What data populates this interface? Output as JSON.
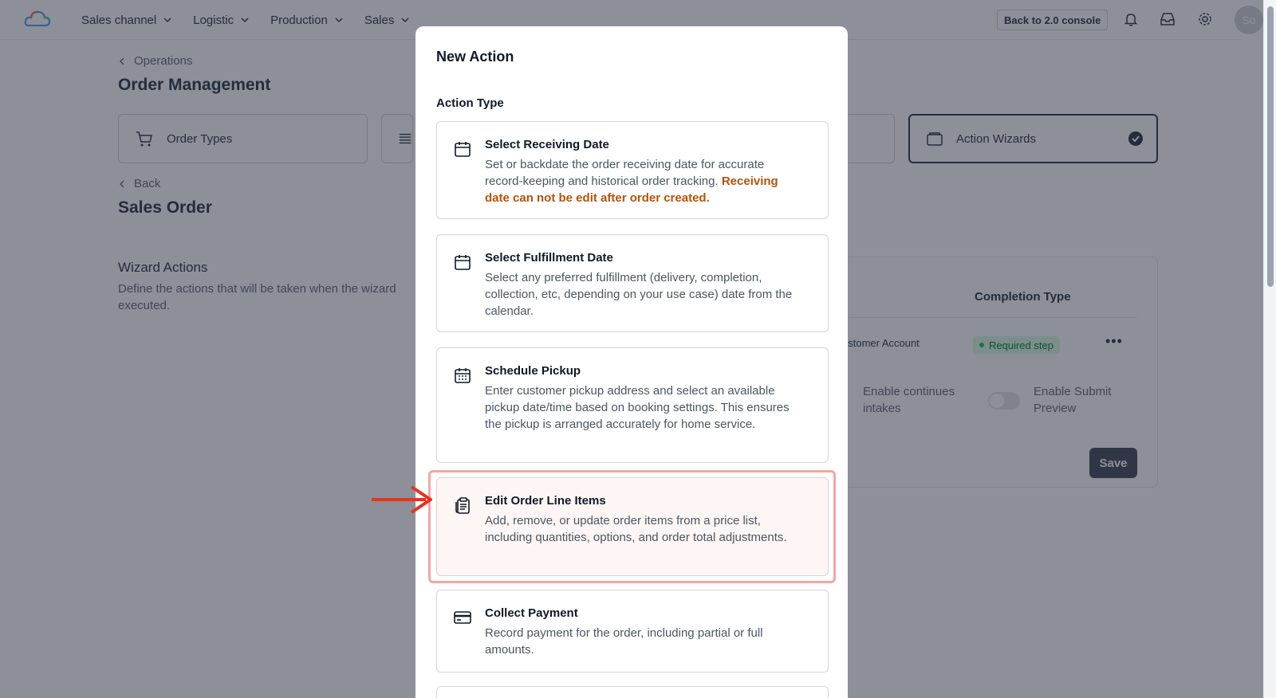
{
  "topbar": {
    "nav": [
      "Sales channel",
      "Logistic",
      "Production",
      "Sales"
    ],
    "console_button": "Back to 2.0 console",
    "avatar_initials": "So"
  },
  "page": {
    "breadcrumb": "Operations",
    "title": "Order Management",
    "tabs": [
      {
        "label": "Order Types",
        "active": false
      },
      {
        "label": "Action Wizards",
        "active": true
      }
    ],
    "back_label": "Back",
    "subtitle": "Sales Order",
    "section_title": "Wizard Actions",
    "section_desc": "Define the actions that will be taken when the wizard executed."
  },
  "panel": {
    "header": "Completion Type",
    "row_cell": "ustomer Account",
    "row_badge": "Required step",
    "toggle_left_label": "Enable continues intakes",
    "toggle_right_label": "Enable Submit Preview",
    "save_label": "Save"
  },
  "modal": {
    "title": "New Action",
    "section_label": "Action Type",
    "options": [
      {
        "title": "Select Receiving Date",
        "desc": "Set or backdate the order receiving date for accurate record-keeping and historical order tracking.",
        "warning": "Receiving date can not be edit after order created.",
        "icon": "calendar-icon"
      },
      {
        "title": "Select Fulfillment Date",
        "desc": "Select any preferred fulfillment (delivery, completion, collection, etc, depending on your use case) date from the calendar.",
        "icon": "calendar-icon"
      },
      {
        "title": "Schedule Pickup",
        "desc": "Enter customer pickup address and select an available pickup date/time based on booking settings. This ensures the pickup is arranged accurately for home service.",
        "icon": "calendar-grid-icon"
      },
      {
        "title": "Edit Order Line Items",
        "desc": "Add, remove, or update order items from a price list, including quantities, options, and order total adjustments.",
        "icon": "clipboard-list-icon",
        "highlighted": true
      },
      {
        "title": "Collect Payment",
        "desc": "Record payment for the order, including partial or full amounts.",
        "icon": "credit-card-icon"
      }
    ]
  },
  "colors": {
    "highlight_frame": "#f3a7a2",
    "arrow": "#e8321f",
    "warning_text": "#b45309"
  }
}
